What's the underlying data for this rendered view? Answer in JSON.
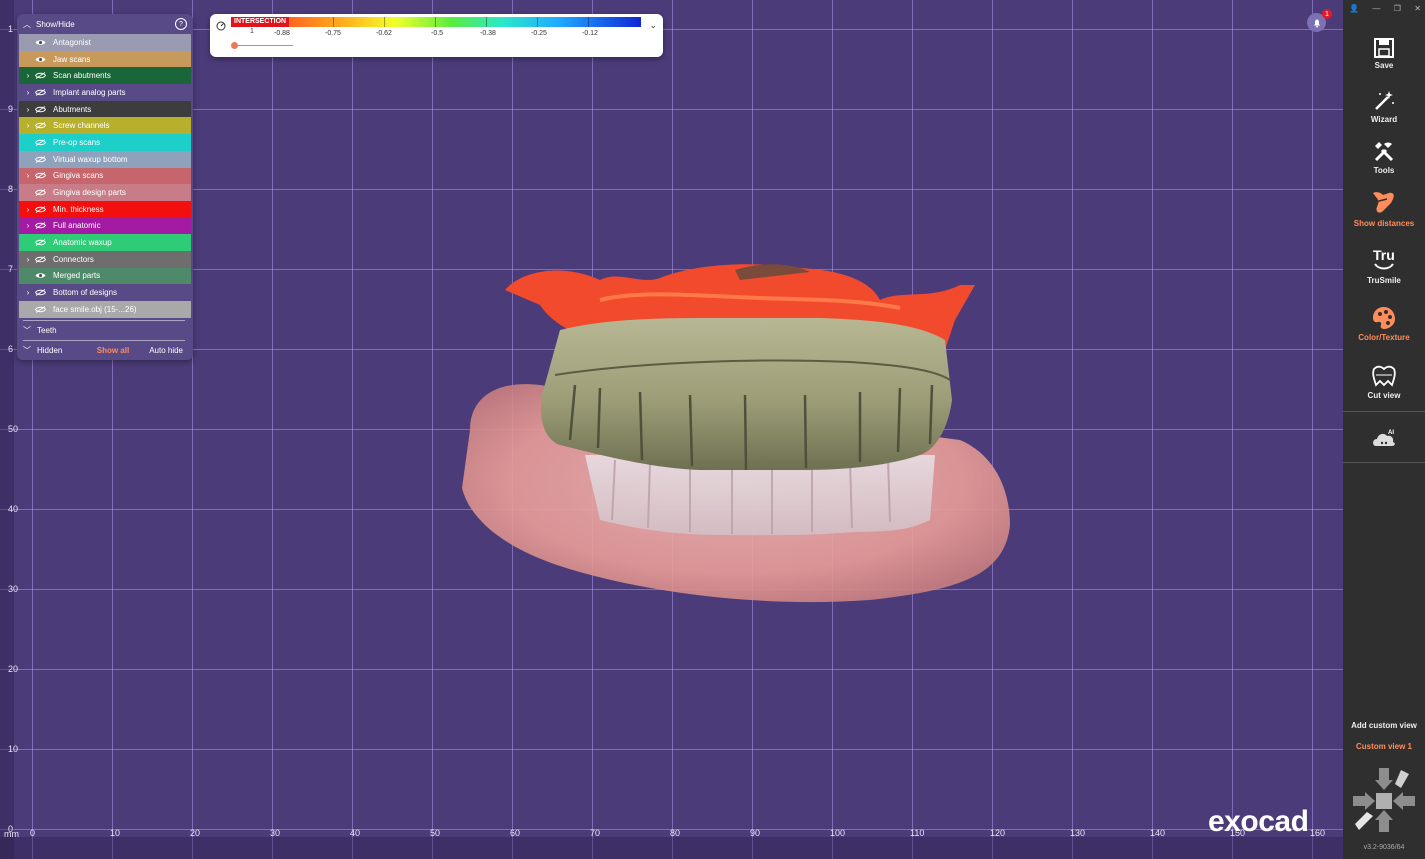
{
  "app": {
    "name": "exocad",
    "version": "v3.2-9036/64"
  },
  "viewport": {
    "unit_label": "mm",
    "y_ticks": [
      "1",
      "9",
      "8",
      "7",
      "6",
      "50",
      "40",
      "30",
      "20",
      "10",
      "0"
    ],
    "x_ticks": [
      "0",
      "10",
      "20",
      "30",
      "40",
      "50",
      "60",
      "70",
      "80",
      "90",
      "100",
      "110",
      "120",
      "130",
      "140",
      "150",
      "160"
    ]
  },
  "showhide": {
    "title": "Show/Hide",
    "items": [
      {
        "label": "Antagonist",
        "color": "#9a9ab0",
        "expandable": false,
        "visible": true
      },
      {
        "label": "Jaw scans",
        "color": "#c79a5c",
        "expandable": false,
        "visible": true
      },
      {
        "label": "Scan abutments",
        "color": "#1a6638",
        "expandable": true,
        "visible": false
      },
      {
        "label": "Implant analog parts",
        "color": "#574a86",
        "expandable": true,
        "visible": false
      },
      {
        "label": "Abutments",
        "color": "#3d3d3d",
        "expandable": true,
        "visible": false
      },
      {
        "label": "Screw channels",
        "color": "#b7b02c",
        "expandable": true,
        "visible": false
      },
      {
        "label": "Pre-op scans",
        "color": "#1ccfc8",
        "expandable": false,
        "visible": false
      },
      {
        "label": "Virtual waxup bottom",
        "color": "#8ea2bc",
        "expandable": false,
        "visible": false
      },
      {
        "label": "Gingiva scans",
        "color": "#c7656c",
        "expandable": true,
        "visible": false
      },
      {
        "label": "Gingiva design parts",
        "color": "#c77c88",
        "expandable": false,
        "visible": false
      },
      {
        "label": "Min. thickness",
        "color": "#f40f0f",
        "expandable": true,
        "visible": false
      },
      {
        "label": "Full anatomic",
        "color": "#a31aa3",
        "expandable": true,
        "visible": false
      },
      {
        "label": "Anatomic waxup",
        "color": "#2fcc78",
        "expandable": false,
        "visible": false
      },
      {
        "label": "Connectors",
        "color": "#6e6e6e",
        "expandable": true,
        "visible": false
      },
      {
        "label": "Merged parts",
        "color": "#4e8a6a",
        "expandable": false,
        "visible": true
      },
      {
        "label": "Bottom of designs",
        "color": "#574a86",
        "expandable": true,
        "visible": false
      },
      {
        "label": "face smile.obj (15-...26)",
        "color": "#a9a9a9",
        "expandable": false,
        "visible": false
      }
    ],
    "teeth_label": "Teeth",
    "hidden_label": "Hidden",
    "show_all": "Show all",
    "auto_hide": "Auto hide"
  },
  "colorbar": {
    "intersection_label": "INTERSECTION",
    "ticks": [
      "-0.88",
      "-0.75",
      "-0.62",
      "-0.5",
      "-0.38",
      "-0.25",
      "-0.12"
    ],
    "slider_value": "1",
    "slider_fraction": 0.0
  },
  "notifications": {
    "count": "1"
  },
  "toolbar": {
    "tools": [
      {
        "label": "Save",
        "icon": "save-icon",
        "active": false
      },
      {
        "label": "Wizard",
        "icon": "wand-icon",
        "active": false
      },
      {
        "label": "Tools",
        "icon": "tools-icon",
        "active": false
      },
      {
        "label": "Show distances",
        "icon": "distance-icon",
        "active": true
      },
      {
        "label": "TruSmile",
        "icon": "trusmile-icon",
        "active": false
      },
      {
        "label": "Color/Texture",
        "icon": "palette-icon",
        "active": true
      },
      {
        "label": "Cut view",
        "icon": "tooth-cut-icon",
        "active": false
      }
    ],
    "cloud_icon": "cloud-ai-icon",
    "add_custom_view": "Add custom view",
    "custom_view_1": "Custom view 1"
  },
  "colors": {
    "viewport_bg": "#4b3b78",
    "accent": "#ff8d5c",
    "toolbar_bg": "#2f2f2f"
  }
}
